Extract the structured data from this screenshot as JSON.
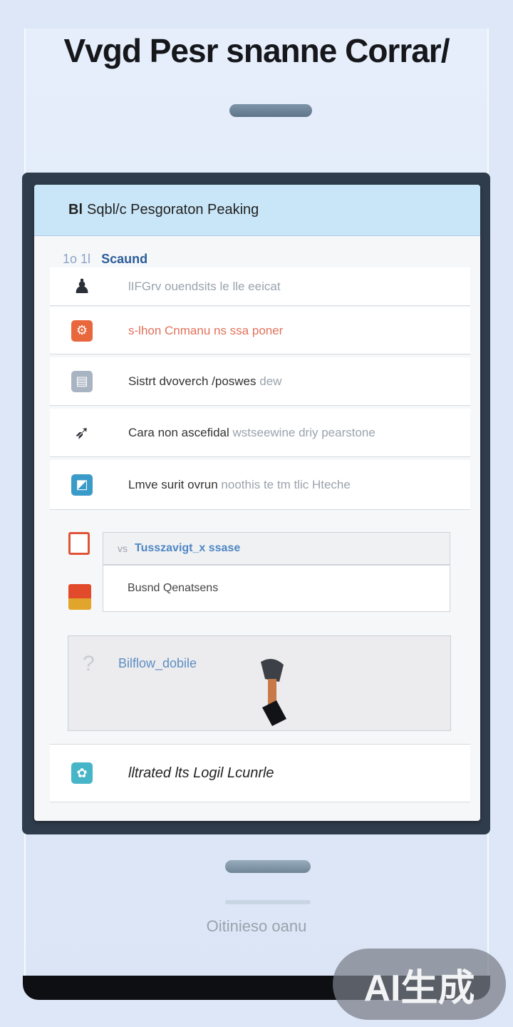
{
  "app": {
    "title": "Vvgd Pesr snanne Corrar/"
  },
  "card": {
    "header_icon": "Bl",
    "header_title": "Sqbl/c Pesgoraton Peaking",
    "section_number": "1o 1l",
    "section_label": "Scaund"
  },
  "rows": [
    {
      "icon": "penguin-icon",
      "color": "#2a2f38",
      "glyph": "♟",
      "text": "",
      "faint": "lIFGrv ouendsits le lle  eeicat"
    },
    {
      "icon": "gear-icon",
      "color": "#e9673d",
      "glyph": "⚙",
      "text": "",
      "orange": "s-lhon Cnmanu ns ssa poner"
    },
    {
      "icon": "folder-icon",
      "color": "#a9b4c2",
      "glyph": "▤",
      "text": "Sistrt dvoverch /poswes",
      "faint": "dew"
    },
    {
      "icon": "bird-icon",
      "color": "#2b2f36",
      "glyph": "➶",
      "text": "Cara non ascefidal",
      "faint": "wstseewine driy pearstone"
    },
    {
      "icon": "map-icon",
      "color": "#3a9bc9",
      "glyph": "◩",
      "text": "Lmve surit ovrun",
      "faint": "noothis te tm tlic Hteche"
    }
  ],
  "fields": [
    {
      "icon": "document-icon",
      "color": "#e05436",
      "prefix": "vs",
      "value": "Tusszavigt_x ssase"
    },
    {
      "icon": "chart-icon",
      "color": "#e2a52c",
      "prefix": "",
      "value": "Busnd Qenatsens"
    }
  ],
  "gallery": {
    "label": "Bilflow_dobile"
  },
  "footer_row": {
    "icon": "flower-icon",
    "color": "#47b5c8",
    "glyph": "✿",
    "text": "lltrated lts Logil Lcunrle"
  },
  "bottom": {
    "caption": "Oitinieso oanu"
  },
  "watermark": "AI生成"
}
